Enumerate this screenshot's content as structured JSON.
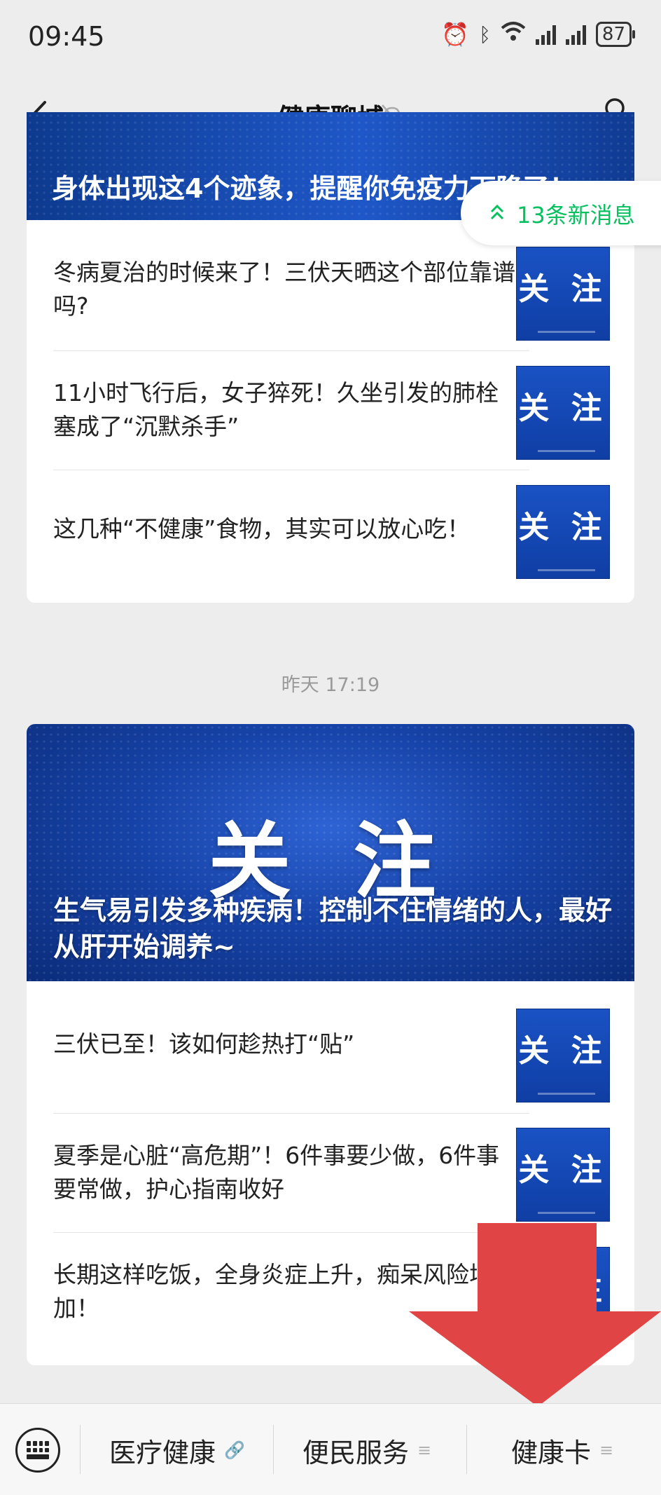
{
  "status_bar": {
    "time": "09:45",
    "battery": "87"
  },
  "nav": {
    "title": "健康聊城"
  },
  "new_messages": {
    "label": "13条新消息"
  },
  "article_group_1": {
    "banner_title": "身体出现这4个迹象，提醒你免疫力下降了！",
    "items": [
      {
        "title": "冬病夏治的时候来了！三伏天晒这个部位靠谱吗?",
        "thumb": "关 注"
      },
      {
        "title": "11小时飞行后，女子猝死！久坐引发的肺栓塞成了“沉默杀手”",
        "thumb": "关 注"
      },
      {
        "title": "这几种“不健康”食物，其实可以放心吃！",
        "thumb": "关 注"
      }
    ]
  },
  "timestamp": "昨天 17:19",
  "article_group_2": {
    "banner_logo": "关 注",
    "banner_title": "生气易引发多种疾病！控制不住情绪的人，最好从肝开始调养~",
    "items": [
      {
        "title": "三伏已至！该如何趁热打“贴”",
        "thumb": "关 注"
      },
      {
        "title": "夏季是心脏“高危期”！6件事要少做，6件事要常做，护心指南收好",
        "thumb": "关 注"
      },
      {
        "title": "长期这样吃饭，全身炎症上升，痴呆风险增加！",
        "thumb": "关 注"
      }
    ]
  },
  "bottom_menu": {
    "items": [
      {
        "label": "医疗健康",
        "icon": "link-icon"
      },
      {
        "label": "便民服务",
        "icon": "menu-icon"
      },
      {
        "label": "健康卡",
        "icon": "menu-icon"
      }
    ]
  },
  "colors": {
    "accent_green": "#07c160",
    "banner_blue": "#1643a8",
    "arrow_red": "#e04444"
  }
}
